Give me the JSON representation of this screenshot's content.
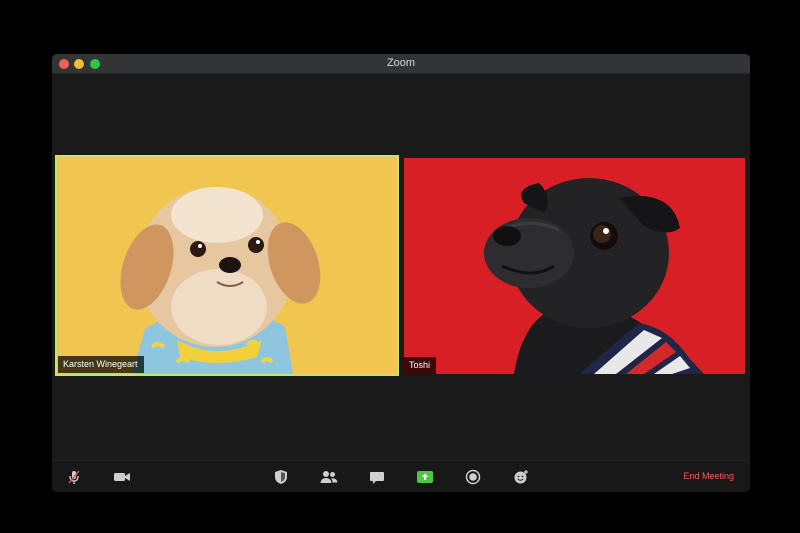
{
  "window": {
    "title": "Zoom"
  },
  "participants": [
    {
      "name": "Karsten Winegeart",
      "active_speaker": true,
      "background_color": "#f1c650"
    },
    {
      "name": "Toshi",
      "active_speaker": false,
      "background_color": "#d91f26"
    }
  ],
  "toolbar": {
    "buttons": [
      {
        "icon": "microphone-muted-icon"
      },
      {
        "icon": "video-camera-icon"
      },
      {
        "icon": "security-shield-icon"
      },
      {
        "icon": "participants-icon"
      },
      {
        "icon": "chat-bubble-icon"
      },
      {
        "icon": "share-screen-icon"
      },
      {
        "icon": "record-icon"
      },
      {
        "icon": "reactions-icon"
      }
    ],
    "end_meeting_label": "End Meeting",
    "accent_green": "#4bc944",
    "end_color": "#ff5a57"
  },
  "colors": {
    "active_speaker_border": "#c7e36d",
    "window_bg": "#1a1a1a",
    "titlebar": "#333436"
  }
}
